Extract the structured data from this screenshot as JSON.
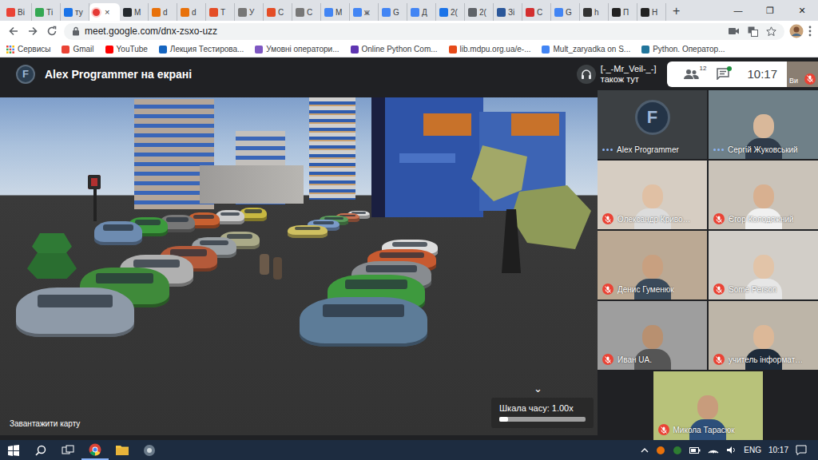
{
  "browser": {
    "tabs": [
      {
        "label": "Ві",
        "selected": false
      },
      {
        "label": "Ті",
        "selected": false
      },
      {
        "label": "ту",
        "selected": false
      },
      {
        "label": "",
        "close": "×",
        "selected": true
      },
      {
        "label": "М",
        "selected": false
      },
      {
        "label": "d",
        "selected": false
      },
      {
        "label": "d",
        "selected": false
      },
      {
        "label": "Т",
        "selected": false
      },
      {
        "label": "У",
        "selected": false
      },
      {
        "label": "С",
        "selected": false
      },
      {
        "label": "С",
        "selected": false
      },
      {
        "label": "М",
        "selected": false
      },
      {
        "label": "ж",
        "selected": false
      },
      {
        "label": "G",
        "selected": false
      },
      {
        "label": "Д",
        "selected": false
      },
      {
        "label": "2(",
        "selected": false
      },
      {
        "label": "2(",
        "selected": false
      },
      {
        "label": "Зі",
        "selected": false
      },
      {
        "label": "С",
        "selected": false
      },
      {
        "label": "G",
        "selected": false
      },
      {
        "label": "h",
        "selected": false
      },
      {
        "label": "П",
        "selected": false
      },
      {
        "label": "Н",
        "selected": false
      }
    ],
    "new_tab": "+",
    "window_controls": [
      "—",
      "❐",
      "✕"
    ],
    "address": "meet.google.com/dnx-zsxo-uzz",
    "bookmarks": [
      "Сервисы",
      "Gmail",
      "YouTube",
      "Лекция Тестирова...",
      "Умовні оператори...",
      "Online Python Com...",
      "lib.mdpu.org.ua/e-...",
      "Mult_zaryadka on S...",
      "Python. Оператор..."
    ]
  },
  "meet": {
    "logo": "F",
    "presenter": "Alex Programmer на екрані",
    "also_here": {
      "name": "[-_-Mr_Veil-_-]",
      "note": "також тут"
    },
    "people_count": "12",
    "chat_unread": true,
    "time": "10:17",
    "self": {
      "label": "Ви",
      "muted": true
    },
    "shared_screen": {
      "load_map": "Завантажити карту",
      "chevron": "⌄",
      "time_scale": "Шкала часу: 1.00x",
      "time_level": 0.1
    },
    "participants": [
      {
        "name": "Alex Programmer",
        "muted": false,
        "speaking": true
      },
      {
        "name": "Сергій Жуковський",
        "muted": false,
        "speaking": true
      },
      {
        "name": "Олександр Криво…",
        "muted": true,
        "speaking": false
      },
      {
        "name": "Єгор Колодяжний",
        "muted": true,
        "speaking": false
      },
      {
        "name": "Денис Гуменюк",
        "muted": true,
        "speaking": false
      },
      {
        "name": "Some Person",
        "muted": true,
        "speaking": false
      },
      {
        "name": "Иван UA.",
        "muted": true,
        "speaking": false
      },
      {
        "name": "учитель інформат…",
        "muted": true,
        "speaking": false
      },
      {
        "name": "Микола Тарасюк",
        "muted": true,
        "speaking": false
      }
    ]
  },
  "taskbar": {
    "language": "ENG",
    "time": "10:17"
  }
}
